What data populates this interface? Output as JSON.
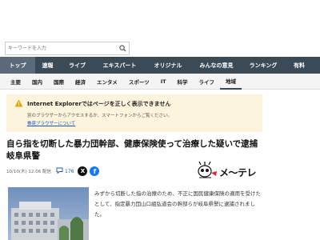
{
  "search": {
    "placeholder": "キーワードを入力"
  },
  "nav1": {
    "items": [
      {
        "label": "トップ",
        "active": true
      },
      {
        "label": "速報"
      },
      {
        "label": "ライブ"
      },
      {
        "label": "エキスパート"
      },
      {
        "label": "オリジナル"
      },
      {
        "label": "みんなの意見"
      },
      {
        "label": "ランキング"
      },
      {
        "label": "有料"
      }
    ]
  },
  "nav2": {
    "items": [
      {
        "label": "主要"
      },
      {
        "label": "国内"
      },
      {
        "label": "国際"
      },
      {
        "label": "経済"
      },
      {
        "label": "エンタメ"
      },
      {
        "label": "スポーツ"
      },
      {
        "label": "IT"
      },
      {
        "label": "科学"
      },
      {
        "label": "ライフ"
      },
      {
        "label": "地域",
        "active": true
      }
    ]
  },
  "notice": {
    "title": "Internet Explorerではページを正しく表示できません",
    "body": "別のブラウザーからアクセスするか、スマートフォンからご覧ください。",
    "link": "推奨ブラウザーについて"
  },
  "article": {
    "headline": "自ら指を切断した暴力団幹部、健康保険使って治療した疑いで逮捕　岐阜県警",
    "meta": "10/10(木) 12:06 配信",
    "comments": "176",
    "source": "メ～テレ",
    "body": "みずから切断した指の治療のため、不正に国民健康保険の適用を受けたとして、指定暴力団山口組弘道会の幹部らが岐阜県警に逮捕されました。"
  },
  "colors": {
    "nav_bg": "#3b4a57",
    "notice_bg": "#fdf4de",
    "link": "#1a56b8",
    "facebook": "#1877f2"
  }
}
